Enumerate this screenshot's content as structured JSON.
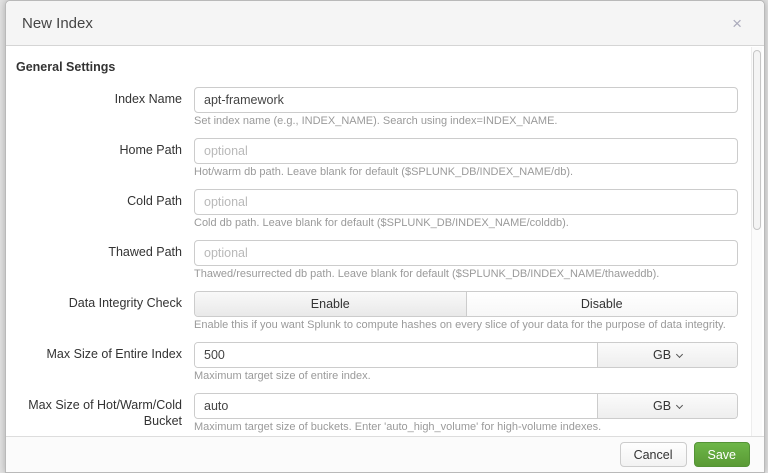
{
  "dialog": {
    "title": "New Index",
    "section_title": "General Settings"
  },
  "icons": {
    "close": "×"
  },
  "fields": [
    {
      "label": "Index Name",
      "type": "text",
      "value": "apt-framework",
      "help": "Set index name (e.g., INDEX_NAME). Search using index=INDEX_NAME."
    },
    {
      "label": "Home Path",
      "type": "text",
      "placeholder": "optional",
      "help": "Hot/warm db path. Leave blank for default ($SPLUNK_DB/INDEX_NAME/db)."
    },
    {
      "label": "Cold Path",
      "type": "text",
      "placeholder": "optional",
      "help": "Cold db path. Leave blank for default ($SPLUNK_DB/INDEX_NAME/colddb)."
    },
    {
      "label": "Thawed Path",
      "type": "text",
      "placeholder": "optional",
      "help": "Thawed/resurrected db path. Leave blank for default ($SPLUNK_DB/INDEX_NAME/thaweddb)."
    },
    {
      "label": "Data Integrity Check",
      "type": "toggle",
      "options": [
        "Enable",
        "Disable"
      ],
      "help": "Enable this if you want Splunk to compute hashes on every slice of your data for the purpose of data integrity."
    },
    {
      "label": "Max Size of Entire Index",
      "type": "text-unit",
      "value": "500",
      "unit": "GB",
      "help": "Maximum target size of entire index."
    },
    {
      "label": "Max Size of Hot/Warm/Cold Bucket",
      "type": "text-unit",
      "value": "auto",
      "unit": "GB",
      "help": "Maximum target size of buckets. Enter 'auto_high_volume' for high-volume indexes."
    }
  ],
  "footer": {
    "cancel_label": "Cancel",
    "save_label": "Save"
  },
  "colors": {
    "save_green": "#65a637",
    "header_bg": "#f5f5f5"
  }
}
